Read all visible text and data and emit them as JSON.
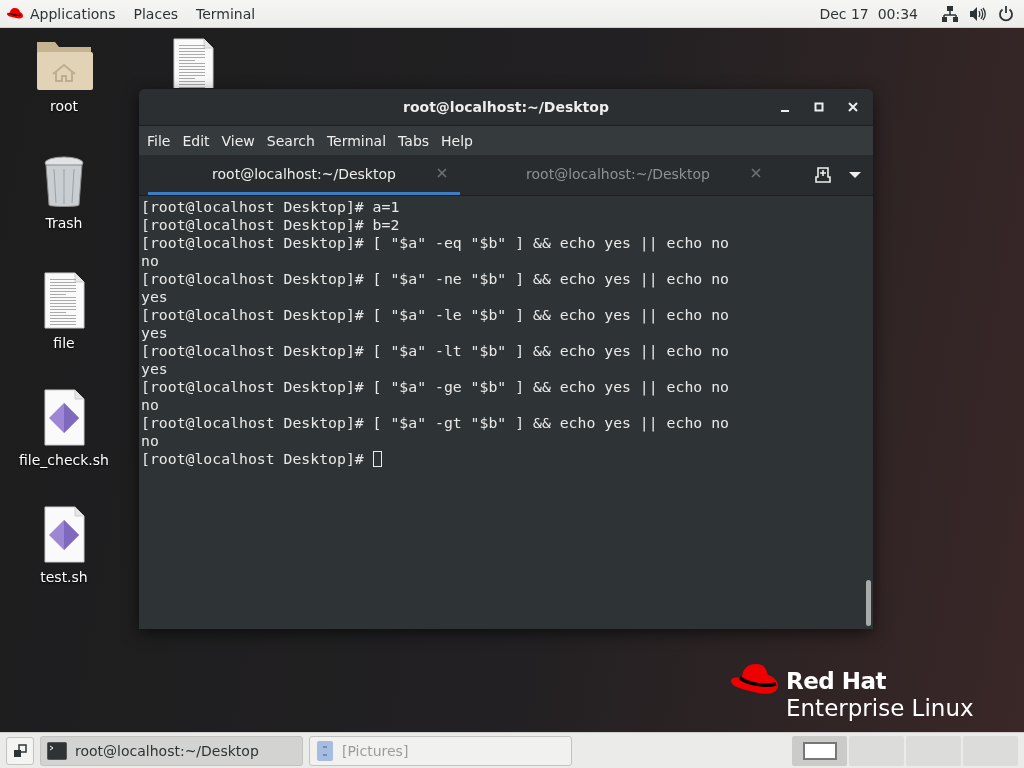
{
  "top_bar": {
    "menus": [
      "Applications",
      "Places",
      "Terminal"
    ],
    "clock": "Dec 17  00:34"
  },
  "desktop_icons": [
    {
      "label": "root",
      "kind": "folder"
    },
    {
      "label": "Trash",
      "kind": "trash"
    },
    {
      "label": "file",
      "kind": "document"
    },
    {
      "label": "file_check.sh",
      "kind": "script"
    },
    {
      "label": "test.sh",
      "kind": "script"
    }
  ],
  "covered_icon": {
    "kind": "document"
  },
  "window": {
    "title": "root@localhost:~/Desktop",
    "menus": [
      "File",
      "Edit",
      "View",
      "Search",
      "Terminal",
      "Tabs",
      "Help"
    ],
    "tabs": [
      {
        "label": "root@localhost:~/Desktop",
        "selected": true
      },
      {
        "label": "root@localhost:~/Desktop",
        "selected": false
      }
    ],
    "terminal_lines": [
      "[root@localhost Desktop]# a=1",
      "[root@localhost Desktop]# b=2",
      "[root@localhost Desktop]# [ \"$a\" -eq \"$b\" ] && echo yes || echo no",
      "no",
      "[root@localhost Desktop]# [ \"$a\" -ne \"$b\" ] && echo yes || echo no",
      "yes",
      "[root@localhost Desktop]# [ \"$a\" -le \"$b\" ] && echo yes || echo no",
      "yes",
      "[root@localhost Desktop]# [ \"$a\" -lt \"$b\" ] && echo yes || echo no",
      "yes",
      "[root@localhost Desktop]# [ \"$a\" -ge \"$b\" ] && echo yes || echo no",
      "no",
      "[root@localhost Desktop]# [ \"$a\" -gt \"$b\" ] && echo yes || echo no",
      "no",
      "[root@localhost Desktop]# "
    ]
  },
  "logo": {
    "brand": "Red Hat",
    "product": "Enterprise Linux"
  },
  "taskbar": {
    "tasks": [
      {
        "label": "root@localhost:~/Desktop",
        "kind": "terminal",
        "selected": true
      },
      {
        "label": "[Pictures]",
        "kind": "folder",
        "selected": false
      }
    ],
    "workspaces": [
      {
        "selected": true
      },
      {
        "selected": false
      },
      {
        "selected": false
      },
      {
        "selected": false
      }
    ]
  }
}
